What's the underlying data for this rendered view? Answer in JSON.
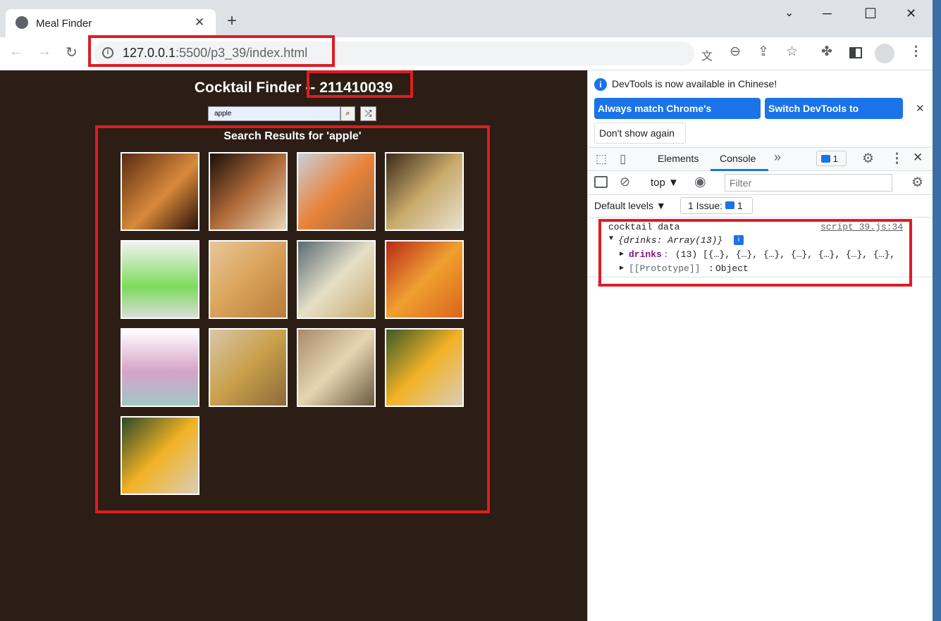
{
  "browser": {
    "tab_title": "Meal Finder",
    "tab_close": "✕",
    "new_tab": "+",
    "url_host": "127.0.0.1",
    "url_rest": ":5500/p3_39/index.html",
    "minimize": "─",
    "maximize": "☐",
    "close": "✕"
  },
  "app": {
    "title": "Cocktail Finder -- 211410039",
    "search_value": "apple",
    "search_icon": "magnifier-icon",
    "random_icon": "shuffle-icon",
    "results_heading": "Search Results for 'apple'",
    "thumbnails": [
      {
        "bg": "linear-gradient(135deg,#5a2b12,#d98a3a 55%,#2a120a)"
      },
      {
        "bg": "linear-gradient(135deg,#1a0f08,#b06a3a 50%,#e9d7b8)"
      },
      {
        "bg": "linear-gradient(135deg,#c8d0d8,#e8833a 50%,#9a6a44)"
      },
      {
        "bg": "linear-gradient(135deg,#3b2a1a,#c7a96a 50%,#e8e2d2)"
      },
      {
        "bg": "linear-gradient(180deg,#f2f2f2,#7bdc5a 60%,#dcdcdc)"
      },
      {
        "bg": "linear-gradient(135deg,#e8c79a,#d9a25a 50%,#b77d3a)"
      },
      {
        "bg": "linear-gradient(135deg,#5a6a72,#e6e0c8 50%,#c7a86a)"
      },
      {
        "bg": "linear-gradient(135deg,#b82a1a,#f0a030 50%,#d9651a)"
      },
      {
        "bg": "linear-gradient(180deg,#ffffff,#d7a2c8 55%,#9fc7c7)"
      },
      {
        "bg": "linear-gradient(135deg,#d9c7a8,#c9a04a 50%,#8a6a3a)"
      },
      {
        "bg": "linear-gradient(135deg,#a88a6a,#e6d6b0 50%,#6a5a40)"
      },
      {
        "bg": "linear-gradient(135deg,#3a5a2a,#f2b224 50%,#d9cdb8)"
      },
      {
        "bg": "linear-gradient(135deg,#2a4a2a,#f2b224 50%,#d9cdb8)"
      }
    ]
  },
  "devtools": {
    "notice": "DevTools is now available in Chinese!",
    "btn_match": "Always match Chrome's language",
    "btn_switch": "Switch DevTools to Chinese",
    "btn_dont_show": "Don't show again",
    "tab_elements": "Elements",
    "tab_console": "Console",
    "more_tabs": "»",
    "issues_count": "1",
    "context": "top",
    "filter_placeholder": "Filter",
    "default_levels": "Default levels ▼",
    "issue_label": "1 Issue:",
    "issue_count": "1",
    "log_message": "cocktail data",
    "log_source": "script_39.js:34",
    "log_object": "{drinks: Array(13)}",
    "drinks_key": "drinks",
    "drinks_value": "(13) [{…}, {…}, {…}, {…}, {…}, {…}, {…},",
    "prototype_key": "[[Prototype]]",
    "prototype_value": "Object",
    "prompt": "›"
  }
}
